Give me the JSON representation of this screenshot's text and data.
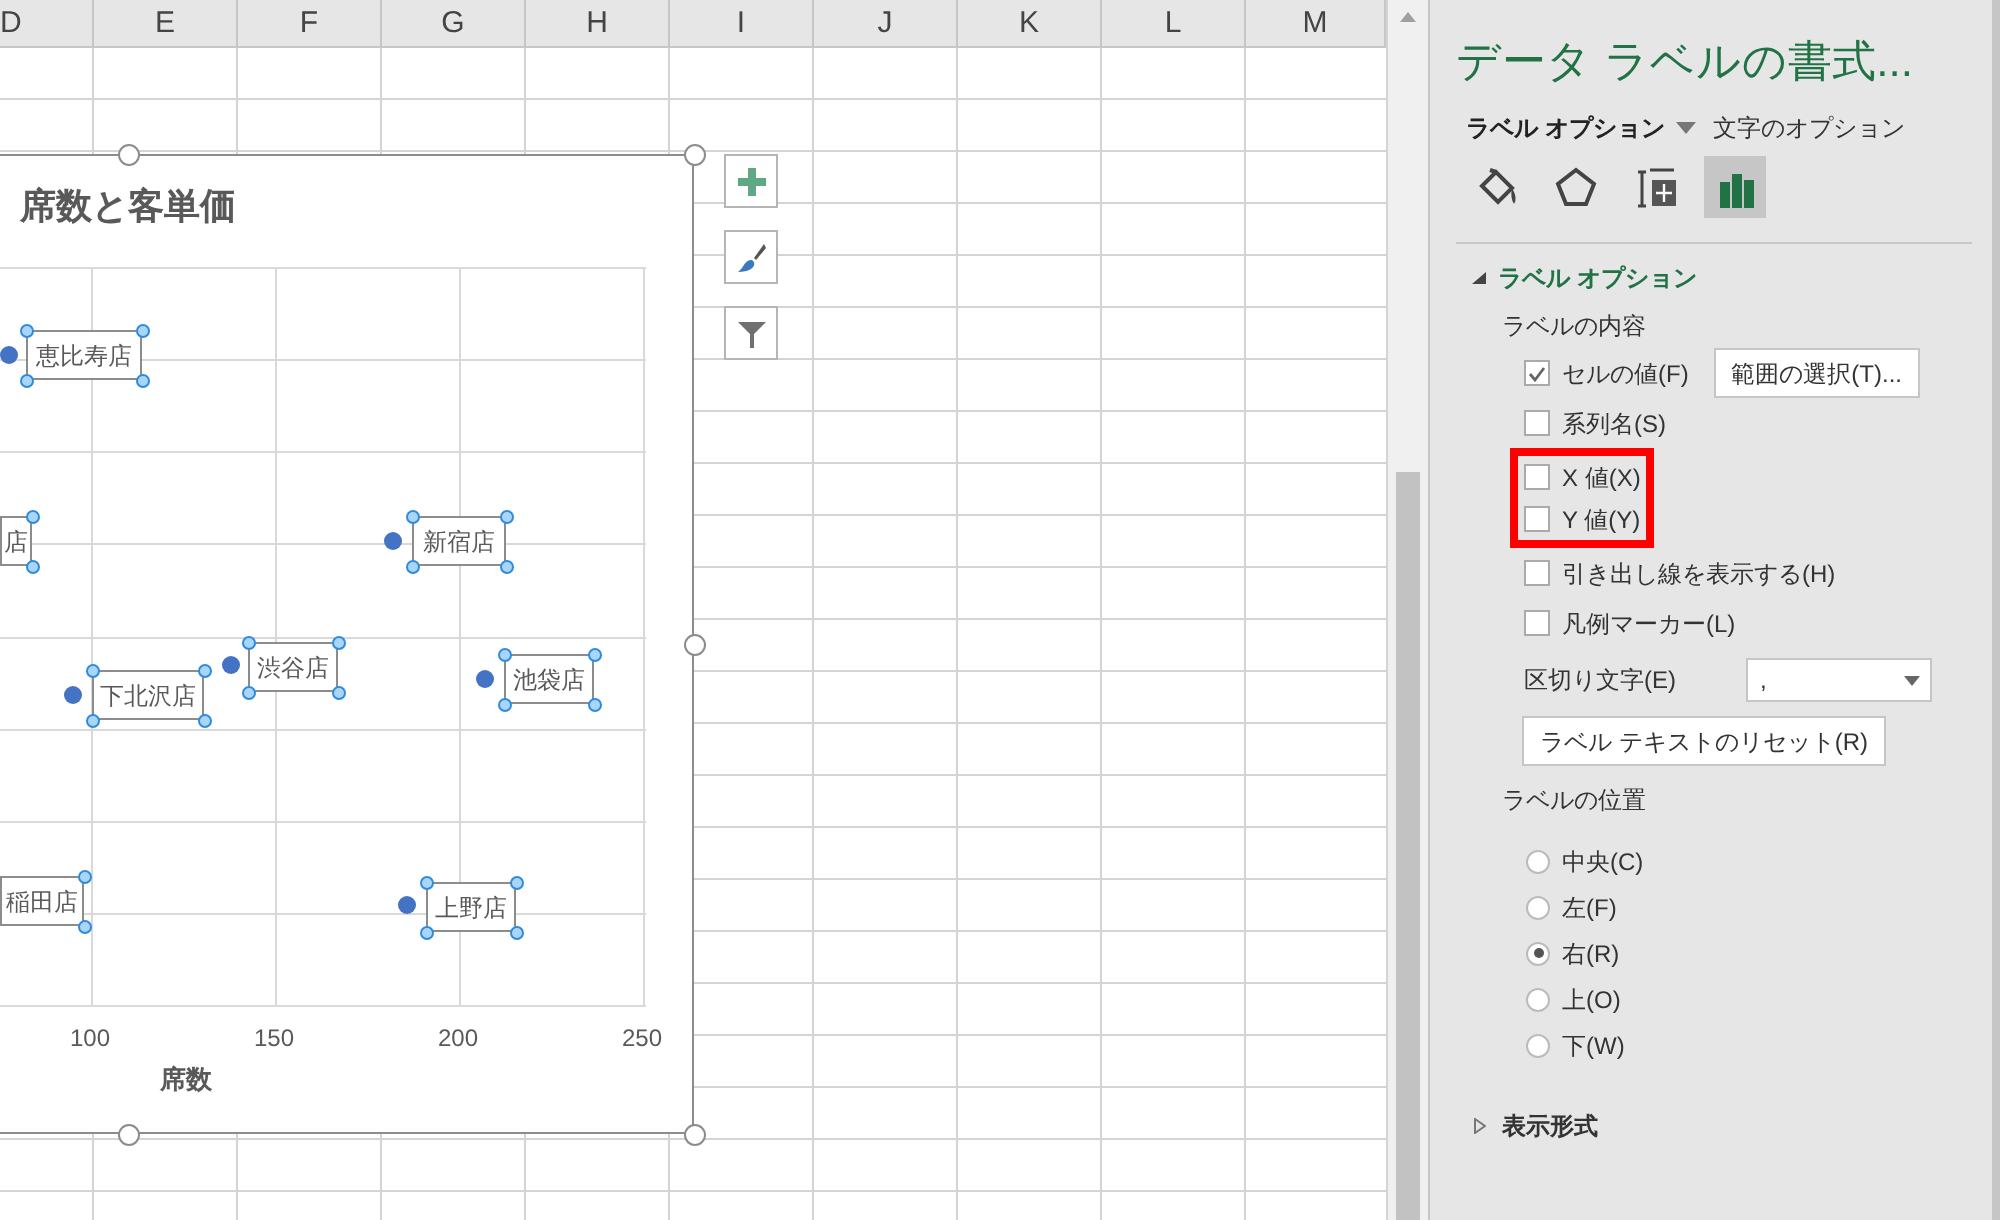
{
  "sheet": {
    "columns": [
      "D",
      "E",
      "F",
      "G",
      "H",
      "I",
      "J",
      "K",
      "L",
      "M"
    ]
  },
  "chart": {
    "title": "席数と客単価",
    "xticks": [
      "100",
      "150",
      "200",
      "250"
    ],
    "xlabel": "席数",
    "data_labels": [
      {
        "text": "恵比寿店"
      },
      {
        "text": "店"
      },
      {
        "text": "新宿店"
      },
      {
        "text": "下北沢店"
      },
      {
        "text": "渋谷店"
      },
      {
        "text": "池袋店"
      },
      {
        "text": "稲田店"
      },
      {
        "text": "上野店"
      }
    ]
  },
  "panel": {
    "title": "データ ラベルの書式...",
    "tabs": [
      {
        "label": "ラベル オプション",
        "selected": true
      },
      {
        "label": "文字のオプション",
        "selected": false
      }
    ],
    "icon_tabs": [
      {
        "kind": "fill",
        "selected": false
      },
      {
        "kind": "effects",
        "selected": false
      },
      {
        "kind": "size",
        "selected": false
      },
      {
        "kind": "options",
        "selected": true
      }
    ],
    "section": {
      "title": "ラベル オプション",
      "expanded": true
    },
    "content_heading": "ラベルの内容",
    "checkboxes": [
      {
        "label": "セルの値(F)",
        "checked": true,
        "highlighted": false
      },
      {
        "label": "系列名(S)",
        "checked": false,
        "highlighted": false
      },
      {
        "label": "X 値(X)",
        "checked": false,
        "highlighted": true
      },
      {
        "label": "Y 値(Y)",
        "checked": false,
        "highlighted": true
      },
      {
        "label": "引き出し線を表示する(H)",
        "checked": false,
        "highlighted": false
      },
      {
        "label": "凡例マーカー(L)",
        "checked": false,
        "highlighted": false
      }
    ],
    "range_button": "範囲の選択(T)...",
    "separator": {
      "label": "区切り文字(E)",
      "value": ","
    },
    "reset_button": "ラベル テキストのリセット(R)",
    "position_heading": "ラベルの位置",
    "positions": [
      {
        "label": "中央(C)",
        "selected": false
      },
      {
        "label": "左(F)",
        "selected": false
      },
      {
        "label": "右(R)",
        "selected": true
      },
      {
        "label": "上(O)",
        "selected": false
      },
      {
        "label": "下(W)",
        "selected": false
      }
    ],
    "number_section": {
      "title": "表示形式",
      "expanded": false
    }
  }
}
